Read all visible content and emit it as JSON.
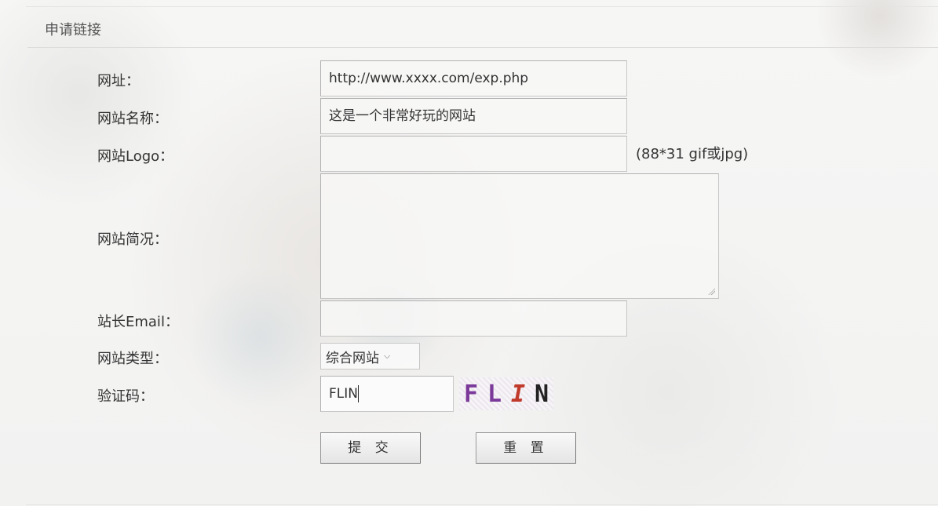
{
  "section": {
    "title": "申请链接"
  },
  "form": {
    "url": {
      "label": "网址：",
      "value": "http://www.xxxx.com/exp.php"
    },
    "site_name": {
      "label": "网站名称：",
      "value": "这是一个非常好玩的网站"
    },
    "logo": {
      "label": "网站Logo：",
      "value": "",
      "hint": "(88*31 gif或jpg)"
    },
    "description": {
      "label": "网站简况：",
      "value": ""
    },
    "email": {
      "label": "站长Email：",
      "value": ""
    },
    "site_type": {
      "label": "网站类型：",
      "selected": "综合网站"
    },
    "captcha": {
      "label": "验证码：",
      "value": "FLIN",
      "image_chars": [
        "F",
        "L",
        "I",
        "N"
      ],
      "image_colors": [
        "#7b3a9a",
        "#7b3a9a",
        "#c0392b",
        "#222222"
      ]
    }
  },
  "buttons": {
    "submit": "提 交",
    "reset": "重 置"
  },
  "icons": {
    "select_arrow": "chevron-down-icon"
  }
}
